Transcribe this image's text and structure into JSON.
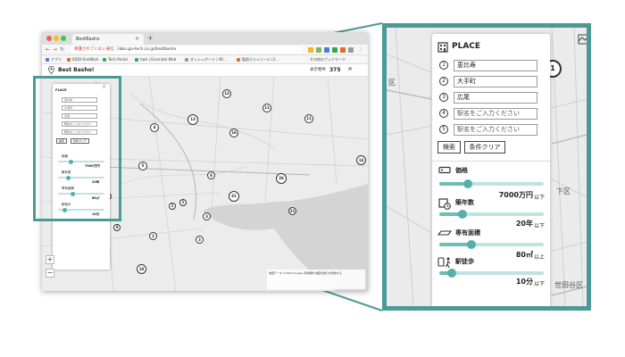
{
  "browser": {
    "tab_title": "BestBasho",
    "url_warning": "保護されていない通信",
    "url_host": "labo.ga-tech.co.jp/bestbasho",
    "bookmarks": [
      "アプリ",
      "KDDI OneWork",
      "Tech Portal",
      "task | Evernote Web",
      "ダッシュボード | Wi...",
      "製造デジュリール (3...",
      "その他のブックマーク"
    ]
  },
  "app": {
    "title": "Best Basho!",
    "count_label": "表示物件",
    "count_value": "375",
    "count_unit": "件"
  },
  "map": {
    "clusters": [
      "13",
      "11",
      "4",
      "13",
      "11",
      "16",
      "5",
      "8",
      "26",
      "41",
      "1",
      "21",
      "14",
      "1",
      "3",
      "2",
      "3",
      "10",
      "1",
      "4"
    ],
    "attribution": "地図データ ©2019 Google 利用規約 地図の誤りを報告する"
  },
  "zoom_map": {
    "clusters": [
      "1"
    ],
    "districts": [
      "下区",
      "世田谷区",
      "区"
    ]
  },
  "panel": {
    "place_title": "PLACE",
    "stations": [
      {
        "num": "1",
        "value": "恵比寿",
        "placeholder": ""
      },
      {
        "num": "2",
        "value": "大手町",
        "placeholder": ""
      },
      {
        "num": "3",
        "value": "広尾",
        "placeholder": ""
      },
      {
        "num": "4",
        "value": "",
        "placeholder": "駅名をご入力ください"
      },
      {
        "num": "5",
        "value": "",
        "placeholder": "駅名をご入力ください"
      }
    ],
    "search_button": "検索",
    "clear_button": "条件クリア",
    "filters": [
      {
        "label": "価格",
        "value": "7000万円",
        "unit": "以下",
        "level": 0.27
      },
      {
        "label": "築年数",
        "value": "20年",
        "unit": "以下",
        "level": 0.22
      },
      {
        "label": "専有面積",
        "value": "80㎡",
        "unit": "以上",
        "level": 0.31
      },
      {
        "label": "駅徒歩",
        "value": "10分",
        "unit": "以下",
        "level": 0.12
      }
    ]
  },
  "colors": {
    "accent": "#4a9a98",
    "slider_track": "#bfe3e1",
    "slider_knob": "#55b0a9",
    "map_bg": "#ededed"
  },
  "icons": [
    "pin-icon",
    "building-icon",
    "calendar-clock-icon",
    "floor-plan-icon",
    "walking-person-icon",
    "map-corner-icon"
  ]
}
